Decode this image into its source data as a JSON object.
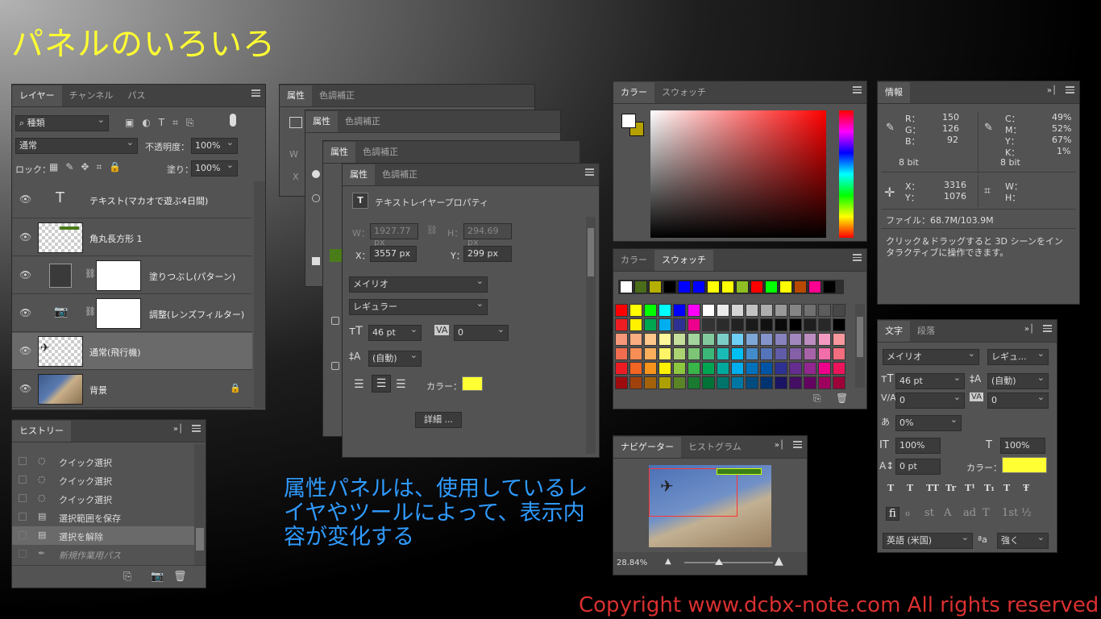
{
  "title": "パネルのいろいろ",
  "caption": "属性パネルは、使用しているレイヤやツールによって、表示内容が変化する",
  "copyright": "Copyright www.dcbx-note.com All rights reserved.",
  "layers": {
    "tabs": [
      "レイヤー",
      "チャンネル",
      "パス"
    ],
    "kind": "種類",
    "blend": "通常",
    "opacity_label": "不透明度：",
    "opacity": "100%",
    "lock_label": "ロック：",
    "fill_label": "塗り：",
    "fill": "100%",
    "items": [
      {
        "name": "テキスト(マカオで遊ぶ4日間)"
      },
      {
        "name": "角丸長方形 1"
      },
      {
        "name": "塗りつぶし(パターン)"
      },
      {
        "name": "調整(レンズフィルター)"
      },
      {
        "name": "通常(飛行機)"
      },
      {
        "name": "背景"
      }
    ]
  },
  "history": {
    "tab": "ヒストリー",
    "items": [
      "クイック選択",
      "クイック選択",
      "クイック選択",
      "選択範囲を保存",
      "選択を解除",
      "新規作業用パス"
    ]
  },
  "props": {
    "tabs": [
      "属性",
      "色調補正"
    ],
    "section": "テキストレイヤープロパティ",
    "w_label": "W：",
    "w": "1927.77 px",
    "h_label": "H：",
    "h": "294.69 px",
    "x_label": "X：",
    "x": "3557 px",
    "y_label": "Y：",
    "y": "299 px",
    "font": "メイリオ",
    "style": "レギュラー",
    "size": "46 pt",
    "tracking": "0",
    "leading": "(自動)",
    "color_label": "カラー：",
    "color": "#ffff33",
    "details": "詳細 ..."
  },
  "color": {
    "tabs": [
      "カラー",
      "スウォッチ"
    ]
  },
  "swatches": {
    "tabs": [
      "カラー",
      "スウォッチ"
    ],
    "recent": [
      "#ffffff",
      "#4b6d1a",
      "#b5b000",
      "#000000",
      "#0000ff",
      "#0000ff",
      "#ffff00",
      "#ffff00",
      "#8fbf22",
      "#ff0000",
      "#00ff00",
      "#ffff00",
      "#b84a00",
      "#ff0090",
      "#000000"
    ],
    "rows": [
      [
        "#ff0000",
        "#ffff00",
        "#00ff00",
        "#00ffff",
        "#0000ff",
        "#ff00ff",
        "#ffffff",
        "#ebebeb",
        "#d6d6d6",
        "#c2c2c2",
        "#adadad",
        "#999999",
        "#858585",
        "#707070",
        "#5c5c5c",
        "#474747"
      ],
      [
        "#ee1d24",
        "#fff100",
        "#00a650",
        "#00aeef",
        "#2e3192",
        "#ec008c",
        "#333333",
        "#2b2b2b",
        "#222222",
        "#1a1a1a",
        "#111111",
        "#0a0a0a",
        "#000000",
        "#1e1e1e",
        "#282828",
        "#000000"
      ],
      [
        "#f7977a",
        "#f9ad81",
        "#fdc68a",
        "#fff79a",
        "#c4df9b",
        "#a2d39c",
        "#82ca9d",
        "#7bcdc8",
        "#6ecff6",
        "#7ea7d8",
        "#8493ca",
        "#8882be",
        "#a187be",
        "#bc8dbf",
        "#f49ac2",
        "#f6989d"
      ],
      [
        "#f26c4f",
        "#f68e55",
        "#fbaf5c",
        "#fff467",
        "#acd372",
        "#7cc576",
        "#3bb878",
        "#1abbb4",
        "#00bff3",
        "#438ccb",
        "#5574b9",
        "#605ca8",
        "#855fa8",
        "#a763a8",
        "#f06ea9",
        "#f26d7d"
      ],
      [
        "#ed1c24",
        "#f26522",
        "#f7941d",
        "#fff200",
        "#8dc63f",
        "#39b54a",
        "#00a651",
        "#00a99d",
        "#00aeef",
        "#0072bc",
        "#0054a6",
        "#2e3192",
        "#662d91",
        "#92278f",
        "#ec008c",
        "#ed145b"
      ],
      [
        "#9e0b0f",
        "#a0410d",
        "#a3620a",
        "#aba000",
        "#598527",
        "#1a7b30",
        "#007236",
        "#00746b",
        "#0076a3",
        "#004b80",
        "#003471",
        "#1b1464",
        "#440e62",
        "#630460",
        "#9e005d",
        "#9e0039"
      ]
    ]
  },
  "info": {
    "tab": "情報",
    "r_label": "R：",
    "r": "150",
    "g_label": "G：",
    "g": "126",
    "b_label": "B：",
    "b": "92",
    "c_label": "C：",
    "c": "49%",
    "m_label": "M：",
    "m": "52%",
    "y_label": "Y：",
    "y": "67%",
    "k_label": "K：",
    "k": "1%",
    "bit1": "8 bit",
    "bit2": "8 bit",
    "x_label": "X：",
    "x": "3316",
    "ylab": "Y：",
    "yv": "1076",
    "w_label": "W：",
    "h_label": "H：",
    "file": "ファイル：68.7M/103.9M",
    "hint": "クリック＆ドラッグすると 3D シーンをインタラクティブに操作できます。"
  },
  "navigator": {
    "tabs": [
      "ナビゲーター",
      "ヒストグラム"
    ],
    "zoom": "28.84%"
  },
  "character": {
    "tabs": [
      "文字",
      "段落"
    ],
    "font": "メイリオ",
    "style": "レギュ...",
    "size": "46 pt",
    "leading": "(自動)",
    "kerning": "0",
    "tracking": "0",
    "vscale_pct": "0%",
    "vscale": "100%",
    "hscale": "100%",
    "baseline": "0 pt",
    "color_label": "カラー：",
    "color": "#ffff33",
    "styles": [
      "T",
      "T",
      "TT",
      "Tr",
      "T¹",
      "T₁",
      "T",
      "Ŧ"
    ],
    "ot": [
      "fi",
      "ℴ",
      "st",
      "A",
      "ad",
      "T",
      "1st",
      "½"
    ],
    "lang": "英語 (米国)",
    "aa_label": "ªa",
    "aa": "強く"
  }
}
